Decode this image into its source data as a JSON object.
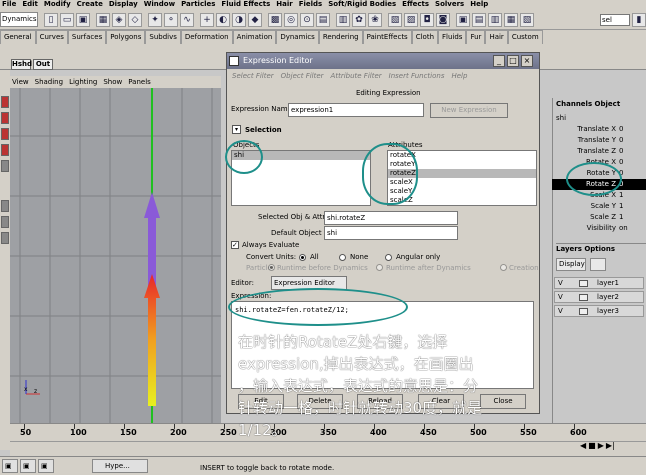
{
  "main_menu": [
    "File",
    "Edit",
    "Modify",
    "Create",
    "Display",
    "Window",
    "Particles",
    "Fluid Effects",
    "Hair",
    "Fields",
    "Soft/Rigid Bodies",
    "Effects",
    "Solvers",
    "Help"
  ],
  "mode_combo": "Dynamics",
  "shelf_tabs": [
    "General",
    "Curves",
    "Surfaces",
    "Polygons",
    "Subdivs",
    "Deformation",
    "Animation",
    "Dynamics",
    "Rendering",
    "PaintEffects",
    "Cloth",
    "Fluids",
    "Fur",
    "Hair",
    "Custom"
  ],
  "shelf_buttons": [
    "Hshd",
    "Out"
  ],
  "viewport_menu": [
    "View",
    "Shading",
    "Lighting",
    "Show",
    "Panels"
  ],
  "viewport_axis": [
    "x",
    "z"
  ],
  "selection_field": "sel",
  "dialog": {
    "title": "Expression Editor",
    "menu": [
      "Select Filter",
      "Object Filter",
      "Attribute Filter",
      "Insert Functions",
      "Help"
    ],
    "heading": "Editing Expression",
    "expr_name_label": "Expression Name",
    "expr_name_value": "expression1",
    "new_expression": "New Expression",
    "selection_label": "Selection",
    "objects_label": "Objects",
    "attributes_label": "Attributes",
    "objects": [
      "shi"
    ],
    "attributes": [
      "rotateX",
      "rotateY",
      "rotateZ",
      "scaleX",
      "scaleY",
      "scaleZ"
    ],
    "selected_attr_index": 2,
    "sel_obj_label": "Selected Obj & Attr",
    "sel_obj_value": "shi.rotateZ",
    "default_obj_label": "Default Object",
    "default_obj_value": "shi",
    "always_evaluate": "Always Evaluate",
    "convert_units_label": "Convert Units:",
    "convert_options": [
      "All",
      "None",
      "Angular only"
    ],
    "particle_label": "Particle:",
    "particle_options": [
      "Runtime before Dynamics",
      "Runtime after Dynamics",
      "Creation"
    ],
    "editor_label": "Editor:",
    "editor_value": "Expression Editor",
    "expression_label": "Expression:",
    "expression_text": "shi.rotateZ=fen.rotateZ/12;",
    "buttons": [
      "Edit",
      "Delete",
      "Reload",
      "Clear",
      "Close"
    ]
  },
  "overlay_lines": [
    "在时针的RotateZ处右键，选择",
    "expression,掉出表达式，在画圈出",
    "，输入表达式，表达式的意思是：分",
    "针转动一格，时针就转动30度，就是",
    "1/12。"
  ],
  "channels": {
    "header": "Channels  Object",
    "object_name": "shi",
    "rows": [
      {
        "name": "Translate X",
        "value": "0"
      },
      {
        "name": "Translate Y",
        "value": "0"
      },
      {
        "name": "Translate Z",
        "value": "0"
      },
      {
        "name": "Rotate X",
        "value": "0"
      },
      {
        "name": "Rotate Y",
        "value": "0"
      },
      {
        "name": "Rotate Z",
        "value": "0"
      },
      {
        "name": "Scale X",
        "value": "1"
      },
      {
        "name": "Scale Y",
        "value": "1"
      },
      {
        "name": "Scale Z",
        "value": "1"
      },
      {
        "name": "Visibility",
        "value": "on"
      }
    ]
  },
  "layers": {
    "header": "Layers  Options",
    "display": "Display",
    "items": [
      "layer1",
      "layer2",
      "layer3"
    ]
  },
  "timeline_ticks": [
    "50",
    "100",
    "150",
    "200",
    "250",
    "300",
    "350",
    "400",
    "450",
    "500",
    "550",
    "600"
  ],
  "taskbar": [
    "Hype...",
    "INSERT to toggle back to rotate mode."
  ],
  "colors": {
    "accent_overlay": "#1e8f8a",
    "title_bar": "#6d7289"
  }
}
